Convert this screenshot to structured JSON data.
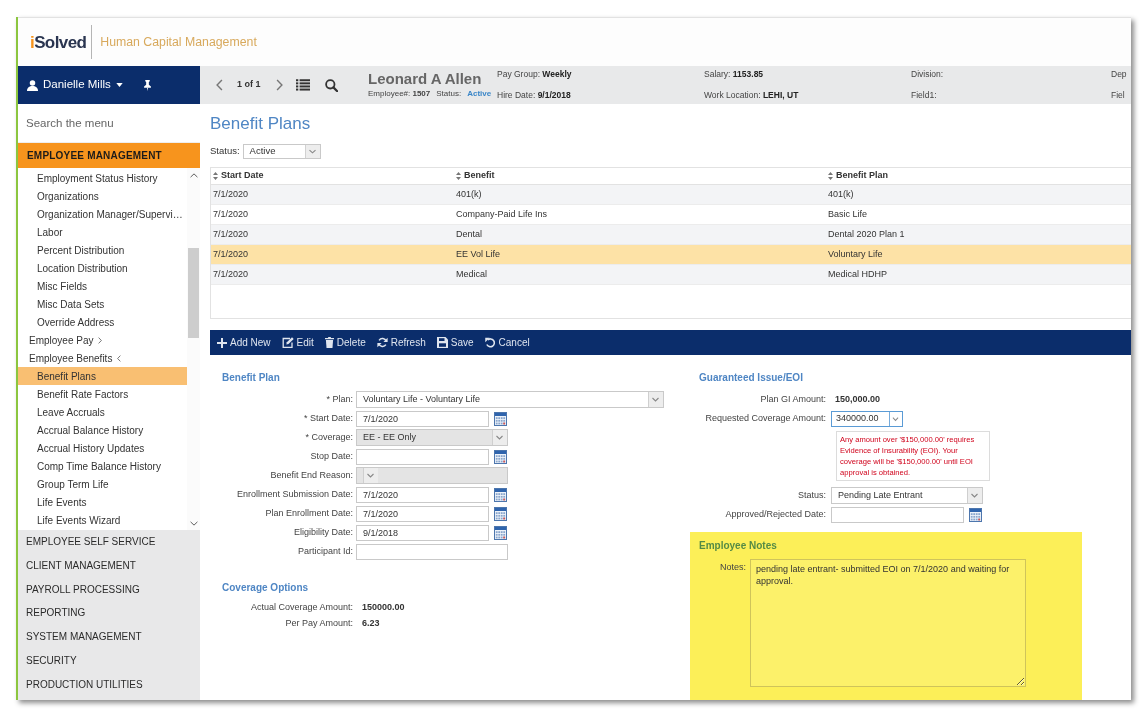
{
  "app_header": {
    "logo": "iSolved",
    "product": "Human Capital Management"
  },
  "user_menu": {
    "user": "Danielle Mills"
  },
  "menu_search": {
    "placeholder": "Search the menu"
  },
  "menu_sections": [
    {
      "label": "EMPLOYEE MANAGEMENT",
      "expanded": true,
      "items": [
        {
          "label": "Employment Status History",
          "kind": "link",
          "selected": false
        },
        {
          "label": "Organizations",
          "kind": "link",
          "selected": false
        },
        {
          "label": "Organization Manager/Supervi…",
          "kind": "link",
          "selected": false
        },
        {
          "label": "Labor",
          "kind": "link",
          "selected": false
        },
        {
          "label": "Percent Distribution",
          "kind": "link",
          "selected": false
        },
        {
          "label": "Location Distribution",
          "kind": "link",
          "selected": false
        },
        {
          "label": "Misc Fields",
          "kind": "link",
          "selected": false
        },
        {
          "label": "Misc Data Sets",
          "kind": "link",
          "selected": false
        },
        {
          "label": "Override Address",
          "kind": "link",
          "selected": false
        },
        {
          "label": "Employee Pay",
          "kind": "group",
          "expanded": false,
          "selected": false
        },
        {
          "label": "Employee Benefits",
          "kind": "group",
          "expanded": true,
          "selected": false,
          "children": [
            {
              "label": "Benefit Plans",
              "kind": "link",
              "selected": true
            },
            {
              "label": "Benefit Rate Factors",
              "kind": "link",
              "selected": false
            },
            {
              "label": "Leave Accruals",
              "kind": "link",
              "selected": false
            },
            {
              "label": "Accrual Balance History",
              "kind": "link",
              "selected": false
            },
            {
              "label": "Accrual History Updates",
              "kind": "link",
              "selected": false
            },
            {
              "label": "Comp Time Balance History",
              "kind": "link",
              "selected": false
            },
            {
              "label": "Group Term Life",
              "kind": "link",
              "selected": false
            },
            {
              "label": "Life Events",
              "kind": "link",
              "selected": false
            },
            {
              "label": "Life Events Wizard",
              "kind": "link",
              "selected": false
            }
          ]
        }
      ]
    },
    {
      "label": "EMPLOYEE SELF SERVICE",
      "expanded": false
    },
    {
      "label": "CLIENT MANAGEMENT",
      "expanded": false
    },
    {
      "label": "PAYROLL PROCESSING",
      "expanded": false
    },
    {
      "label": "REPORTING",
      "expanded": false
    },
    {
      "label": "SYSTEM MANAGEMENT",
      "expanded": false
    },
    {
      "label": "SECURITY",
      "expanded": false
    },
    {
      "label": "PRODUCTION UTILITIES",
      "expanded": false
    }
  ],
  "employee_bar": {
    "pager": "1 of 1",
    "name": "Leonard A Allen",
    "number": "Employee#: **1507**",
    "status_label": "Status:",
    "status": "Active",
    "info_columns": [
      [
        "Pay Group: **Weekly**",
        "Hire Date: **9/1/2018**"
      ],
      [
        "Salary: **1153.85**",
        "Work Location: **LEHI, UT**"
      ],
      [
        "Division:",
        "Field1:"
      ],
      [
        "Dep",
        "Fiel"
      ]
    ]
  },
  "page_title": "Benefit Plans",
  "status_filter": {
    "label": "Status:",
    "value": "Active"
  },
  "table": {
    "columns": [
      "Start Date",
      "Benefit",
      "Benefit Plan"
    ],
    "rows": [
      {
        "cells": [
          "7/1/2020",
          "401(k)",
          "401(k)"
        ],
        "selected": false
      },
      {
        "cells": [
          "7/1/2020",
          "Company-Paid Life Ins",
          "Basic Life"
        ],
        "selected": false
      },
      {
        "cells": [
          "7/1/2020",
          "Dental",
          "Dental 2020 Plan 1"
        ],
        "selected": false
      },
      {
        "cells": [
          "7/1/2020",
          "EE Vol Life",
          "Voluntary Life"
        ],
        "selected": true
      },
      {
        "cells": [
          "7/1/2020",
          "Medical",
          "Medical HDHP"
        ],
        "selected": false
      }
    ]
  },
  "toolbar": [
    "Add New",
    "Edit",
    "Delete",
    "Refresh",
    "Save",
    "Cancel"
  ],
  "benefit_plan": {
    "title": "Benefit Plan",
    "fields": [
      {
        "label": "* Plan:",
        "kind": "wide-select",
        "value": "Voluntary Life - Voluntary Life",
        "disabled": false
      },
      {
        "label": "* Start Date:",
        "kind": "date",
        "value": "7/1/2020",
        "disabled": false
      },
      {
        "label": "* Coverage:",
        "kind": "select",
        "value": "EE - EE Only",
        "disabled": true
      },
      {
        "label": "Stop Date:",
        "kind": "date",
        "disabled": false
      },
      {
        "label": "Benefit End Reason:",
        "kind": "select",
        "disabled": true
      },
      {
        "label": "Enrollment Submission Date:",
        "kind": "date",
        "value": "7/1/2020",
        "disabled": false
      },
      {
        "label": "Plan Enrollment Date:",
        "kind": "date",
        "value": "7/1/2020",
        "disabled": false
      },
      {
        "label": "Eligibility Date:",
        "kind": "date",
        "value": "9/1/2018",
        "disabled": false
      },
      {
        "label": "Participant Id:",
        "kind": "text",
        "disabled": false
      }
    ]
  },
  "coverage_options": {
    "title": "Coverage Options",
    "rows": [
      {
        "label": "Actual Coverage Amount:",
        "value": "150000.00"
      },
      {
        "label": "Per Pay Amount:",
        "value": "6.23"
      }
    ]
  },
  "eoi": {
    "title": "Guaranteed Issue/EOI",
    "plan_gi": {
      "label": "Plan GI Amount:",
      "value": "150,000.00"
    },
    "requested": {
      "label": "Requested Coverage Amount:",
      "value": "340000.00",
      "focused": true
    },
    "warning": "Any amount over '$150,000.00' requires Evidence of Insurability (EOI). Your coverage will be '$150,000.00' until EOI approval is obtained.",
    "status": {
      "label": "Status:",
      "value": "Pending Late Entrant"
    },
    "approved_date": {
      "label": "Approved/Rejected Date:"
    }
  },
  "employee_notes": {
    "title": "Employee Notes",
    "label": "Notes:",
    "value": "pending late entrant- submitted EOI on 7/1/2020 and waiting for approval."
  }
}
